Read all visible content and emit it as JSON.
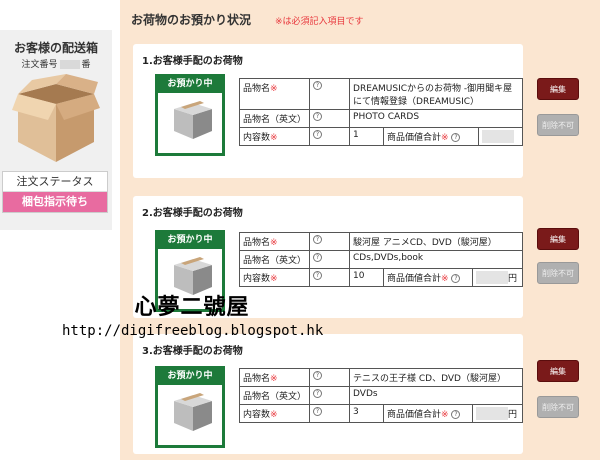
{
  "sidebar": {
    "title": "お客様の配送箱",
    "order_label": "注文番号",
    "order_suffix": "番",
    "status_label": "注文ステータス",
    "status_value": "梱包指示待ち"
  },
  "panel": {
    "title": "お荷物のお預かり状況",
    "note": "※は必須記入項目です"
  },
  "badge_label": "お預かり中",
  "labels": {
    "item_name": "品物名",
    "item_name_en": "品物名（英文）",
    "quantity": "内容数",
    "value_total": "商品価値合計",
    "required_mark": "※",
    "help_mark": "?",
    "edit_button": "編集",
    "cancel_button": "削除不可",
    "yen": "円"
  },
  "items": [
    {
      "title": "1.お客様手配のお荷物",
      "name": "DREAMUSICからのお荷物 -御用聞キ屋にて情報登録（DREAMUSIC）",
      "name_en": "PHOTO CARDS",
      "quantity": "1"
    },
    {
      "title": "2.お客様手配のお荷物",
      "name": "駿河屋 アニメCD、DVD（駿河屋）",
      "name_en": "CDs,DVDs,book",
      "quantity": "10"
    },
    {
      "title": "3.お客様手配のお荷物",
      "name": "テニスの王子様 CD、DVD（駿河屋）",
      "name_en": "DVDs",
      "quantity": "3"
    }
  ],
  "watermark": {
    "line1": "心夢二號屋",
    "line2": "http://digifreeblog.blogspot.hk"
  }
}
